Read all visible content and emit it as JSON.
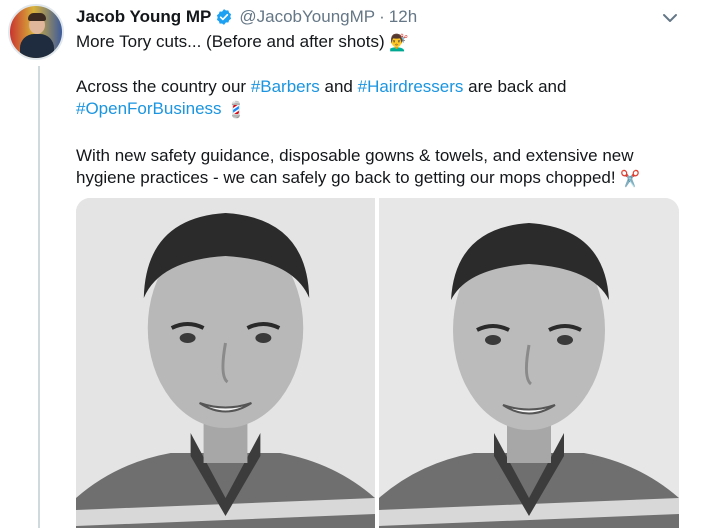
{
  "tweet": {
    "display_name": "Jacob Young MP",
    "handle": "@JacobYoungMP",
    "separator": "·",
    "time": "12h",
    "text_line1": "More Tory cuts... (Before and after shots)",
    "line2_pre": "Across the country our ",
    "hashtag_barbers": "#Barbers",
    "line2_and": " and ",
    "hashtag_hairdressers": "#Hairdressers",
    "line2_post": " are back and",
    "hashtag_open": "#OpenForBusiness",
    "line4": "With new safety guidance, disposable gowns & towels, and extensive new",
    "line5": "hygiene practices - we can safely go back to getting our mops chopped!",
    "emoji_haircut": "💇‍♂️",
    "emoji_barber_pole": "💈",
    "emoji_scissors": "✂️"
  },
  "icons": {
    "verified": "verified-badge-icon",
    "menu": "chevron-down-icon"
  },
  "colors": {
    "link": "#1b95e0",
    "secondary_text": "#657786",
    "verified": "#1da1f2"
  }
}
